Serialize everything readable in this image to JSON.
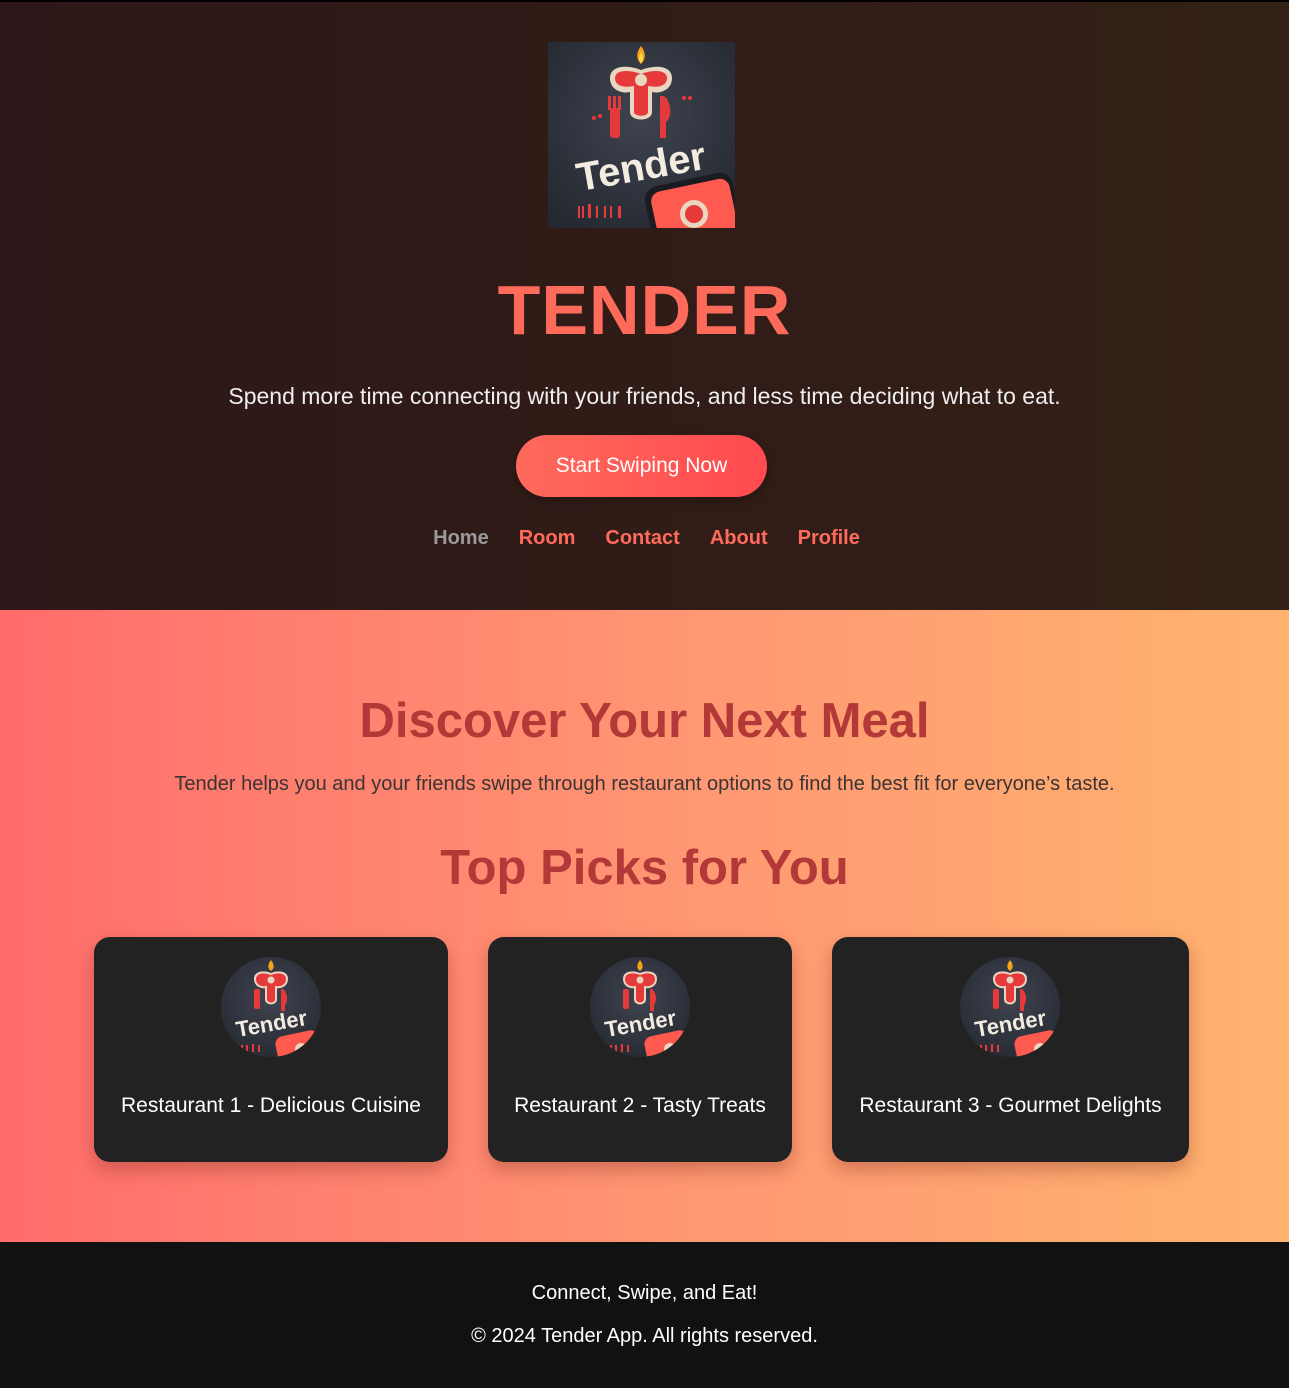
{
  "hero": {
    "logo_text": "Tender",
    "title": "TENDER",
    "tagline": "Spend more time connecting with your friends, and less time deciding what to eat.",
    "cta_label": "Start Swiping Now"
  },
  "nav": {
    "items": [
      {
        "label": "Home",
        "active": true
      },
      {
        "label": "Room"
      },
      {
        "label": "Contact"
      },
      {
        "label": "About"
      },
      {
        "label": "Profile"
      }
    ]
  },
  "discover": {
    "title": "Discover Your Next Meal",
    "description": "Tender helps you and your friends swipe through restaurant options to find the best fit for everyone’s taste.",
    "picks_title": "Top Picks for You",
    "cards": [
      {
        "name": "Restaurant 1 - Delicious Cuisine",
        "logo_text": "Tender"
      },
      {
        "name": "Restaurant 2 - Tasty Treats",
        "logo_text": "Tender"
      },
      {
        "name": "Restaurant 3 - Gourmet Delights",
        "logo_text": "Tender"
      }
    ]
  },
  "footer": {
    "line1": "Connect, Swipe, and Eat!",
    "line2": "© 2024 Tender App. All rights reserved."
  },
  "colors": {
    "accent": "#ff6b5b",
    "heading": "#b33838",
    "card_bg": "#222222",
    "footer_bg": "#111111"
  }
}
